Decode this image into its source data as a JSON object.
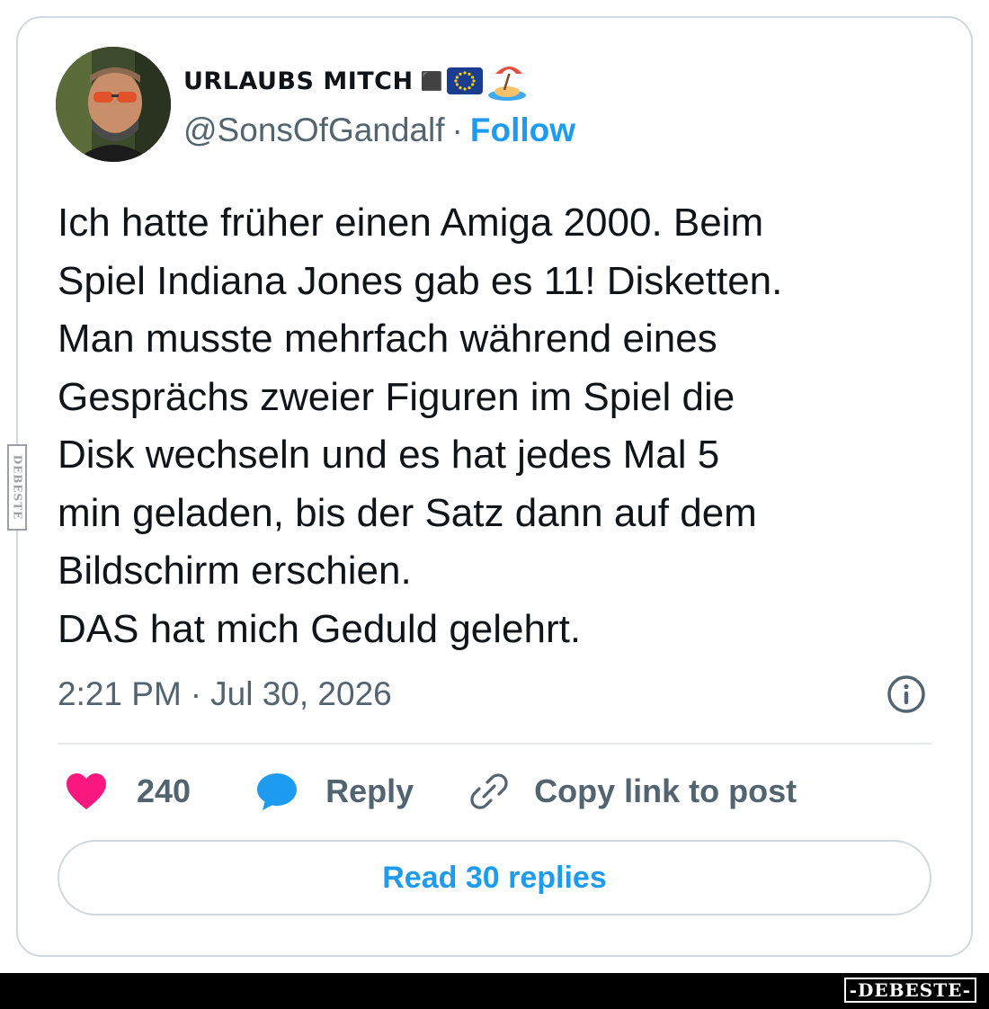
{
  "author": {
    "display_name": "URLAUBS MITCH",
    "badge_glyph": "⬛",
    "emojis": [
      "eu-flag-icon",
      "desert-island-icon"
    ],
    "handle": "@SonsOfGandalf",
    "separator": "·",
    "follow_label": "Follow"
  },
  "tweet": {
    "lines": [
      "Ich hatte früher einen Amiga 2000. Beim",
      "Spiel Indiana Jones gab es 11! Disketten.",
      "Man musste mehrfach während eines",
      "Gesprächs zweier Figuren im Spiel die",
      "Disk wechseln und es hat jedes Mal 5",
      "min geladen, bis der Satz dann auf dem",
      "Bildschirm erschien.",
      "DAS hat mich Geduld gelehrt."
    ],
    "time": "2:21 PM",
    "separator": "·",
    "date": "Jul 30, 2026"
  },
  "actions": {
    "like_count": "240",
    "reply_label": "Reply",
    "copy_label": "Copy link to post"
  },
  "read_replies_label": "Read 30 replies",
  "watermark": {
    "side": "DEBESTE",
    "footer": "-DEBESTE-"
  },
  "colors": {
    "accent": "#1d9bf0",
    "like": "#f91880",
    "text": "#0f1419",
    "secondary": "#536471",
    "border": "#cfd9de"
  }
}
